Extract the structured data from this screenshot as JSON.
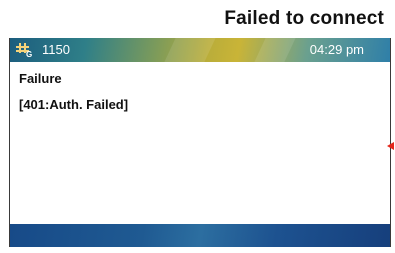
{
  "frame": {
    "title": "Failed to connect"
  },
  "status_bar": {
    "line_icon": "phone-line-status-icon",
    "extension": "1150",
    "time": "04:29 pm"
  },
  "message": {
    "title": "Failure",
    "detail": "[401:Auth. Failed]"
  },
  "annotation": {
    "pointer_icon": "red-pointer-arrow-icon",
    "color": "#e3261b"
  },
  "colors": {
    "status_bar_gradient": [
      "#1c5d7e",
      "#b9ad3a",
      "#2f7fa8"
    ],
    "softkey_bar": "#1f5a92",
    "text": "#111111"
  }
}
